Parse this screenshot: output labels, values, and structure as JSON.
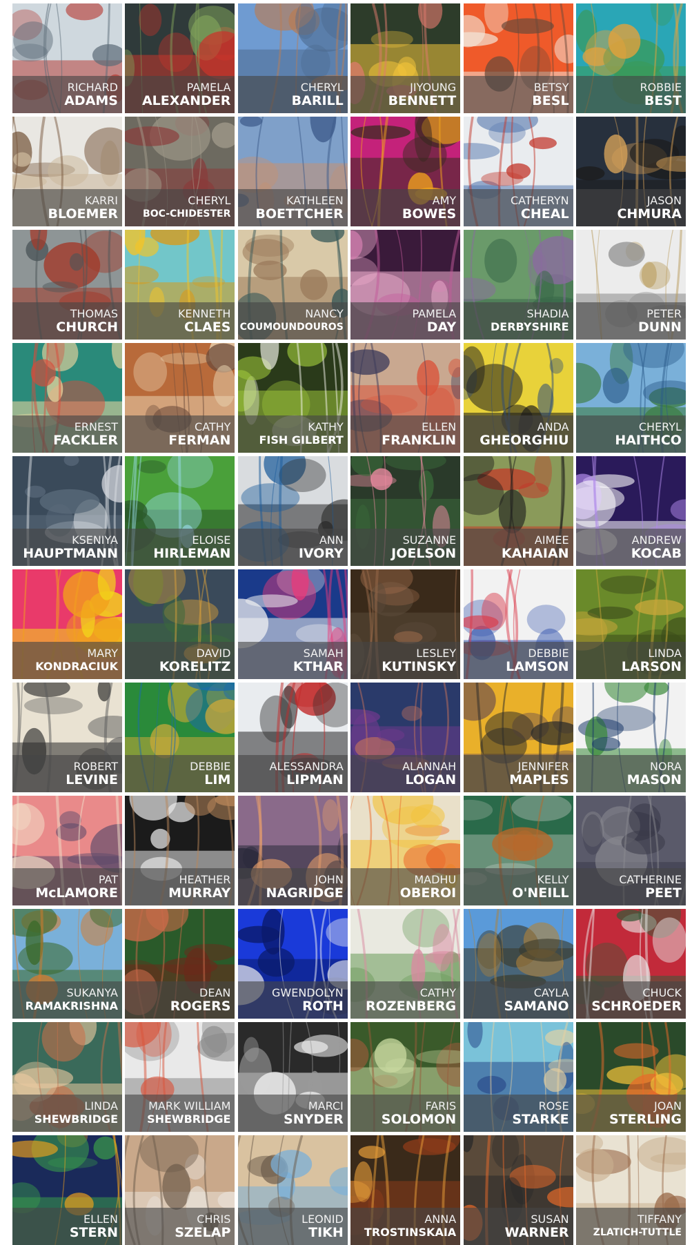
{
  "artists": [
    {
      "first": "RICHARD",
      "last": "ADAMS",
      "icon": "building-painting",
      "colors": [
        "#cfd8de",
        "#5b6b77",
        "#b8423a"
      ]
    },
    {
      "first": "PAMELA",
      "last": "ALEXANDER",
      "icon": "traffic-lights-rain",
      "colors": [
        "#2f3a3a",
        "#7fa05a",
        "#c8342a"
      ]
    },
    {
      "first": "CHERYL",
      "last": "BARILL",
      "icon": "mountain-landscape",
      "colors": [
        "#6f9bd1",
        "#b97d55",
        "#4c6a8f"
      ]
    },
    {
      "first": "JIYOUNG",
      "last": "BENNETT",
      "icon": "flowers",
      "colors": [
        "#2d3c2a",
        "#e07a6e",
        "#f0c23b"
      ]
    },
    {
      "first": "BETSY",
      "last": "BESL",
      "icon": "teapot-sculpture",
      "colors": [
        "#ef5a2a",
        "#6b4a3a",
        "#f2e6d9"
      ]
    },
    {
      "first": "ROBBIE",
      "last": "BEST",
      "icon": "abstract-blobs",
      "colors": [
        "#2aa6b6",
        "#e7a23a",
        "#3a9a5a"
      ]
    },
    {
      "first": "KARRI",
      "last": "BLOEMER",
      "icon": "owl",
      "colors": [
        "#e9e7e2",
        "#7a5a40",
        "#cbb79a"
      ]
    },
    {
      "first": "CHERYL",
      "last": "BOC-CHIDESTER",
      "icon": "glass-corner",
      "colors": [
        "#6d6a60",
        "#a39c8c",
        "#8a3a3a"
      ]
    },
    {
      "first": "KATHLEEN",
      "last": "BOETTCHER",
      "icon": "portrait-sunglasses",
      "colors": [
        "#7fa0c9",
        "#3c5a8a",
        "#c49173"
      ]
    },
    {
      "first": "AMY",
      "last": "BOWES",
      "icon": "bee",
      "colors": [
        "#c4227a",
        "#f2a51b",
        "#3a2a20"
      ]
    },
    {
      "first": "CATHERYN",
      "last": "CHEAL",
      "icon": "children-drawing",
      "colors": [
        "#e9ecef",
        "#c3392e",
        "#5a7bb0"
      ]
    },
    {
      "first": "JASON",
      "last": "CHMURA",
      "icon": "stripes-branches",
      "colors": [
        "#27303d",
        "#d9a45a",
        "#1b1b1b"
      ]
    },
    {
      "first": "THOMAS",
      "last": "CHURCH",
      "icon": "lighthouse",
      "colors": [
        "#8e9596",
        "#4b5558",
        "#a23a2a"
      ]
    },
    {
      "first": "KENNETH",
      "last": "CLAES",
      "icon": "gold-rings",
      "colors": [
        "#72c6c9",
        "#f2c42a",
        "#d99a1a"
      ]
    },
    {
      "first": "NANCY",
      "last": "COUMOUNDOUROS",
      "icon": "woman-dress",
      "colors": [
        "#d9c9a8",
        "#3a5a5a",
        "#9a7a5a"
      ]
    },
    {
      "first": "PAMELA",
      "last": "DAY",
      "icon": "purple-flower",
      "colors": [
        "#3a1a3a",
        "#c25a9a",
        "#f0b0d0"
      ]
    },
    {
      "first": "SHADIA",
      "last": "DERBYSHIRE",
      "icon": "trees-landscape",
      "colors": [
        "#6a9a6a",
        "#8a6aa0",
        "#3a6a4a"
      ]
    },
    {
      "first": "PETER",
      "last": "DUNN",
      "icon": "wire-sculpture",
      "colors": [
        "#ececec",
        "#b89a5a",
        "#8a8a8a"
      ]
    },
    {
      "first": "ERNEST",
      "last": "FACKLER",
      "icon": "graphic-bird",
      "colors": [
        "#2a8a7a",
        "#d94a3a",
        "#f2d9a0"
      ]
    },
    {
      "first": "CATHY",
      "last": "FERMAN",
      "icon": "rock-collage",
      "colors": [
        "#b86a3a",
        "#6a4a3a",
        "#e9d2b0"
      ]
    },
    {
      "first": "KATHY",
      "last": "FISH GILBERT",
      "icon": "flower-bouquet",
      "colors": [
        "#2a3a1a",
        "#f2f2e9",
        "#9ac23a"
      ]
    },
    {
      "first": "ELLEN",
      "last": "FRANKLIN",
      "icon": "cafe-sketch",
      "colors": [
        "#c9a890",
        "#3a3a5a",
        "#d9533a"
      ]
    },
    {
      "first": "ANDA",
      "last": "GHEORGHIU",
      "icon": "blue-shoe",
      "colors": [
        "#e8d23a",
        "#2a4a7a",
        "#1b1b1b"
      ]
    },
    {
      "first": "CHERYL",
      "last": "HAITHCO",
      "icon": "sailboat",
      "colors": [
        "#7ab0d9",
        "#2a5a8a",
        "#3a7a3a"
      ]
    },
    {
      "first": "KSENIYA",
      "last": "HAUPTMANN",
      "icon": "woman-horse",
      "colors": [
        "#3a4a5a",
        "#d9dde2",
        "#5a6a7a"
      ]
    },
    {
      "first": "ELOISE",
      "last": "HIRLEMAN",
      "icon": "green-trees",
      "colors": [
        "#4aa03a",
        "#9ad9e9",
        "#2a5a2a"
      ]
    },
    {
      "first": "ANN",
      "last": "IVORY",
      "icon": "blue-glass-tiles",
      "colors": [
        "#d9dcdf",
        "#1a5a9a",
        "#2a2a2a"
      ]
    },
    {
      "first": "SUZANNE",
      "last": "JOELSON",
      "icon": "pink-flowers",
      "colors": [
        "#2a3a2a",
        "#e98aa0",
        "#3a6a3a"
      ]
    },
    {
      "first": "AIMEE",
      "last": "KAHAIAN",
      "icon": "blackbird-branch",
      "colors": [
        "#8a9a5a",
        "#1b1b1b",
        "#c23a2a"
      ]
    },
    {
      "first": "ANDREW",
      "last": "KOCAB",
      "icon": "purple-burst",
      "colors": [
        "#2a1a5a",
        "#b08ae9",
        "#ffffff"
      ]
    },
    {
      "first": "MARY",
      "last": "KONDRACIUK",
      "icon": "sunset-gradient",
      "colors": [
        "#e93a6a",
        "#f2a21b",
        "#f2d91b"
      ]
    },
    {
      "first": "DAVID",
      "last": "KORELITZ",
      "icon": "shoreline",
      "colors": [
        "#3a4a5a",
        "#d9a03a",
        "#3a6a3a"
      ]
    },
    {
      "first": "SAMAH",
      "last": "KTHAR",
      "icon": "abstract-paint",
      "colors": [
        "#1a3a8a",
        "#e93a7a",
        "#f2f2f2"
      ]
    },
    {
      "first": "LESLEY",
      "last": "KUTINSKY",
      "icon": "two-faces",
      "colors": [
        "#3a2a1a",
        "#9a6a4a",
        "#5a4a3a"
      ]
    },
    {
      "first": "DEBBIE",
      "last": "LAMSON",
      "icon": "flowers-vase",
      "colors": [
        "#f2f2f2",
        "#d93a4a",
        "#3a5ab0"
      ]
    },
    {
      "first": "LINDA",
      "last": "LARSON",
      "icon": "moss-branch",
      "colors": [
        "#6a8a2a",
        "#c9a83a",
        "#3a4a1a"
      ]
    },
    {
      "first": "ROBERT",
      "last": "LEVINE",
      "icon": "man-sketch",
      "colors": [
        "#e9e2d2",
        "#5a5a5a",
        "#2a2a2a"
      ]
    },
    {
      "first": "DEBBIE",
      "last": "LIM",
      "icon": "peacock",
      "colors": [
        "#2a8a3a",
        "#1a6ab0",
        "#c9a83a"
      ]
    },
    {
      "first": "ALESSANDRA",
      "last": "LIPMAN",
      "icon": "woman-red-coat",
      "colors": [
        "#e9ecef",
        "#c22a2a",
        "#2a2a2a"
      ]
    },
    {
      "first": "ALANNAH",
      "last": "LOGAN",
      "icon": "two-women",
      "colors": [
        "#2a3a6a",
        "#c2705a",
        "#6a3a8a"
      ]
    },
    {
      "first": "JENNIFER",
      "last": "MAPLES",
      "icon": "afro-portrait",
      "colors": [
        "#e9b02a",
        "#2a2a2a",
        "#7a5a4a"
      ]
    },
    {
      "first": "NORA",
      "last": "MASON",
      "icon": "ceramic-vases",
      "colors": [
        "#f2f2f2",
        "#1a3a6a",
        "#3a8a3a"
      ]
    },
    {
      "first": "PAT",
      "last": "McLAMORE",
      "icon": "pink-sunset-sea",
      "colors": [
        "#e98a8a",
        "#f2e0c9",
        "#5a4a6a"
      ]
    },
    {
      "first": "HEATHER",
      "last": "MURRAY",
      "icon": "clay-bird",
      "colors": [
        "#1b1b1b",
        "#b8865a",
        "#e9e9e9"
      ]
    },
    {
      "first": "JOHN",
      "last": "NAGRIDGE",
      "icon": "winter-sunset",
      "colors": [
        "#8a6a8a",
        "#e9a06a",
        "#2a2a3a"
      ]
    },
    {
      "first": "MADHU",
      "last": "OBEROI",
      "icon": "autumn-birches",
      "colors": [
        "#e9e0c9",
        "#e96a2a",
        "#f2c23a"
      ]
    },
    {
      "first": "KELLY",
      "last": "O'NEILL",
      "icon": "green-metal",
      "colors": [
        "#2a6a4a",
        "#b8682a",
        "#9ab0a0"
      ]
    },
    {
      "first": "CATHERINE",
      "last": "PEET",
      "icon": "stormy-sky",
      "colors": [
        "#5a5a6a",
        "#8a8a90",
        "#3a3a4a"
      ]
    },
    {
      "first": "SUKANYA",
      "last": "RAMAKRISHNA",
      "icon": "autumn-trees",
      "colors": [
        "#7ab0d9",
        "#d97a2a",
        "#3a6a2a"
      ]
    },
    {
      "first": "DEAN",
      "last": "ROGERS",
      "icon": "girl-violin",
      "colors": [
        "#2a5a2a",
        "#c96a4a",
        "#6a2a1a"
      ]
    },
    {
      "first": "GWENDOLYN",
      "last": "ROTH",
      "icon": "blue-forest",
      "colors": [
        "#1a3ad9",
        "#f2f2f2",
        "#0a1a6a"
      ]
    },
    {
      "first": "CATHY",
      "last": "ROZENBERG",
      "icon": "pink-garden",
      "colors": [
        "#e9e9e0",
        "#d98aa0",
        "#6a9a5a"
      ]
    },
    {
      "first": "CAYLA",
      "last": "SAMANO",
      "icon": "plains-sky",
      "colors": [
        "#5a9ad9",
        "#b0823a",
        "#3a3a2a"
      ]
    },
    {
      "first": "CHUCK",
      "last": "SCHROEDER",
      "icon": "red-boats",
      "colors": [
        "#c22a3a",
        "#e9e9e9",
        "#3a5a3a"
      ]
    },
    {
      "first": "LINDA",
      "last": "SHEWBRIDGE",
      "icon": "sea-turtle",
      "colors": [
        "#3a6a5a",
        "#c9704a",
        "#e9c9a0"
      ]
    },
    {
      "first": "MARK WILLIAM",
      "last": "SHEWBRIDGE",
      "icon": "orange-car",
      "colors": [
        "#e9e9e9",
        "#d9533a",
        "#8a8a8a"
      ]
    },
    {
      "first": "MARCI",
      "last": "SNYDER",
      "icon": "water-splash",
      "colors": [
        "#2a2a2a",
        "#9a9a9a",
        "#f2f2f2"
      ]
    },
    {
      "first": "FARIS",
      "last": "SOLOMON",
      "icon": "tall-trees",
      "colors": [
        "#3a5a2a",
        "#9a5a3a",
        "#c9d9a0"
      ]
    },
    {
      "first": "ROSE",
      "last": "STARKE",
      "icon": "beach-scene",
      "colors": [
        "#7ac2d9",
        "#e9d2a0",
        "#2a4a8a"
      ]
    },
    {
      "first": "JOAN",
      "last": "STERLING",
      "icon": "autumn-forest",
      "colors": [
        "#2a4a2a",
        "#e96a2a",
        "#f2c23a"
      ]
    },
    {
      "first": "ELLEN",
      "last": "STERN",
      "icon": "star-tiles",
      "colors": [
        "#1a2a5a",
        "#f2a21b",
        "#3a9a4a"
      ]
    },
    {
      "first": "CHRIS",
      "last": "SZELAP",
      "icon": "winter-road",
      "colors": [
        "#c9a88a",
        "#6a5a4a",
        "#e9e2d9"
      ]
    },
    {
      "first": "LEONID",
      "last": "TIKH",
      "icon": "old-building",
      "colors": [
        "#d9c2a0",
        "#6a5a4a",
        "#7ab0d9"
      ]
    },
    {
      "first": "ANNA",
      "last": "TROSTINSKAIA",
      "icon": "house-autumn",
      "colors": [
        "#3a2a1a",
        "#e9a03a",
        "#8a3a1a"
      ]
    },
    {
      "first": "SUSAN",
      "last": "WARNER",
      "icon": "sunset-window",
      "colors": [
        "#5a4a3a",
        "#e96a2a",
        "#2a2a2a"
      ]
    },
    {
      "first": "TIFFANY",
      "last": "ZLATICH-TUTTLE",
      "icon": "geometric-wire",
      "colors": [
        "#e9e2d2",
        "#9a6a4a",
        "#c9b090"
      ]
    }
  ]
}
